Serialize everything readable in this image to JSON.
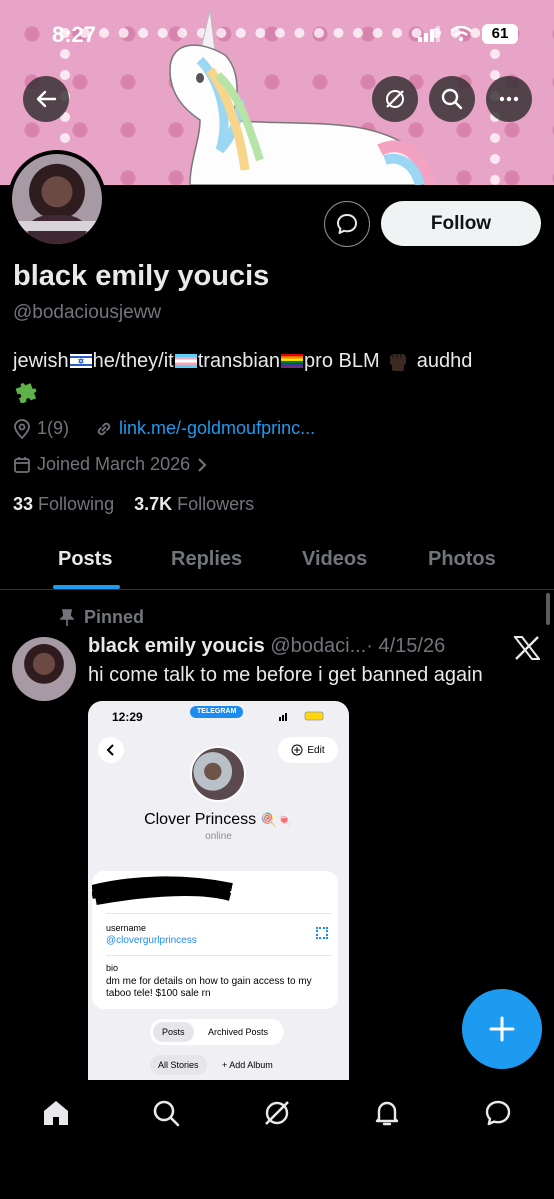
{
  "status_bar": {
    "time": "8:27",
    "battery": "61"
  },
  "profile": {
    "name": "black emily youcis",
    "handle": "@bodaciousjeww",
    "bio_parts": [
      "jewish",
      "he/they/it",
      "transbian",
      "pro BLM ",
      " audhd"
    ],
    "bio_emoji": [
      "israel-flag",
      "trans-flag",
      "rainbow-flag",
      "raised-fist-dark",
      "puzzle-piece"
    ],
    "location": "1(9)",
    "link": "link.me/-goldmoufprinc...",
    "joined": "Joined March 2026",
    "following_count": "33",
    "following_label": "Following",
    "followers_count": "3.7K",
    "followers_label": "Followers"
  },
  "buttons": {
    "follow": "Follow"
  },
  "tabs": [
    {
      "label": "Posts",
      "active": true
    },
    {
      "label": "Replies",
      "active": false
    },
    {
      "label": "Videos",
      "active": false
    },
    {
      "label": "Photos",
      "active": false
    }
  ],
  "pinned_post": {
    "pinned_label": "Pinned",
    "author": "black emily youcis",
    "handle": "@bodaci...",
    "date": "· 4/15/26",
    "text": "hi come talk to me before i get banned again",
    "embedded_screenshot": {
      "time": "12:29",
      "badge": "TELEGRAM",
      "edit": "Edit",
      "name": "Clover Princess",
      "status": "online",
      "username_label": "username",
      "username": "@clovergurlprincess",
      "bio_label": "bio",
      "bio": "dm me for details on how to gain access to my taboo tele! $100 sale rn",
      "tab_posts": "Posts",
      "tab_archived": "Archived Posts",
      "all_stories": "All Stories",
      "add_album": "+ Add Album"
    }
  },
  "colors": {
    "accent": "#1d9bf0",
    "background": "#000000",
    "secondary_text": "#71767b",
    "banner": "#e7a4c6"
  },
  "icons": [
    "back-arrow-icon",
    "grok-icon",
    "search-icon",
    "more-icon",
    "message-icon",
    "location-icon",
    "link-icon",
    "calendar-icon",
    "pin-icon",
    "x-logo-icon",
    "compose-icon",
    "home-icon",
    "explore-icon",
    "notifications-icon",
    "messages-icon"
  ]
}
